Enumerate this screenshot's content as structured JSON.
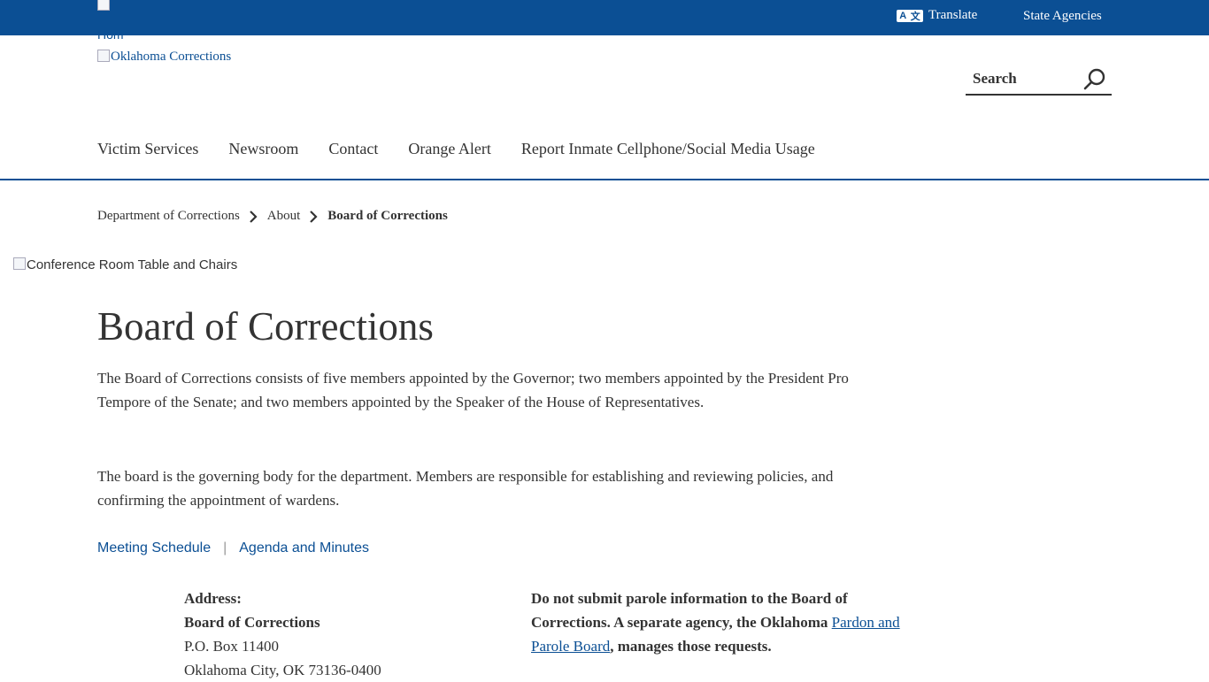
{
  "topbar": {
    "translate_label": "Translate",
    "translate_icon": "translate-icon",
    "agencies_label": "State Agencies",
    "background_color": "#0b4f94"
  },
  "header": {
    "home_alt": "Hom",
    "logo_alt": "Oklahoma Corrections",
    "search_placeholder": "Search",
    "search_icon": "search-icon"
  },
  "nav": {
    "items": [
      "Victim Services",
      "Newsroom",
      "Contact",
      "Orange Alert",
      "Report Inmate Cellphone/Social Media Usage"
    ]
  },
  "breadcrumb": {
    "items": [
      "Department of Corrections",
      "About"
    ],
    "current": "Board of Corrections"
  },
  "hero": {
    "alt": "Conference Room Table and Chairs"
  },
  "main": {
    "title": "Board of Corrections",
    "paragraph1": "The Board of Corrections consists of five members appointed by the Governor; two members appointed by the President Pro Tempore of the Senate; and two members appointed by the Speaker of the House of Representatives.",
    "paragraph2": "The board is the governing body for the department. Members are responsible for establishing and reviewing policies, and confirming the appointment of wardens.",
    "links": {
      "meeting": "Meeting Schedule",
      "separator": "|",
      "agenda": "Agenda and Minutes"
    },
    "address": {
      "label": "Address:",
      "name": "Board of Corrections",
      "line1": "P.O. Box 11400",
      "line2": "Oklahoma City, OK 73136-0400"
    },
    "notice": {
      "text_before": "Do not submit parole information to the Board of Corrections. A separate agency, the Oklahoma ",
      "link": "Pardon and Parole Board",
      "text_after": ", manages those requests."
    }
  },
  "colors": {
    "accent": "#0b4f94",
    "text": "#333333"
  }
}
